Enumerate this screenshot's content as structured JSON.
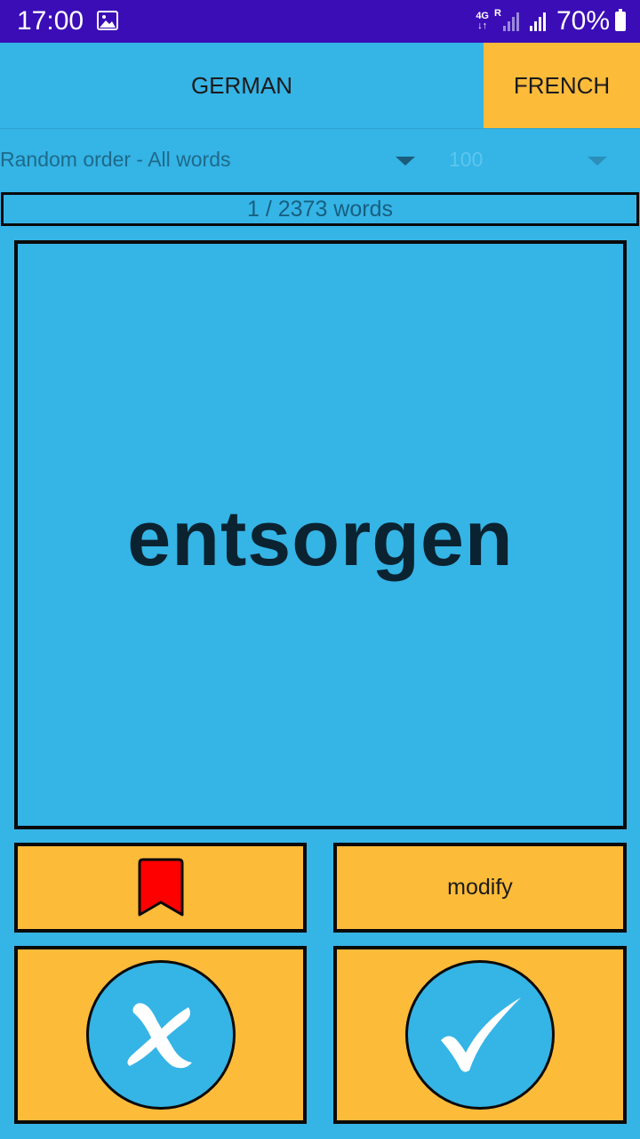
{
  "status_bar": {
    "time": "17:00",
    "network": "4G",
    "roaming": "R",
    "battery": "70%"
  },
  "languages": {
    "source": "GERMAN",
    "target": "FRENCH"
  },
  "filters": {
    "order": "Random order - All words",
    "count": "100"
  },
  "progress": {
    "text": "1 / 2373 words",
    "current": 1,
    "total": 2373
  },
  "card": {
    "word": "entsorgen"
  },
  "actions": {
    "modify_label": "modify",
    "bookmark_icon": "bookmark-icon",
    "wrong_icon": "cross-icon",
    "right_icon": "checkmark-icon"
  },
  "colors": {
    "background": "#35B4E6",
    "accent": "#FDBB3A",
    "status_bar": "#3B0DB6",
    "bookmark": "#FF0000"
  }
}
